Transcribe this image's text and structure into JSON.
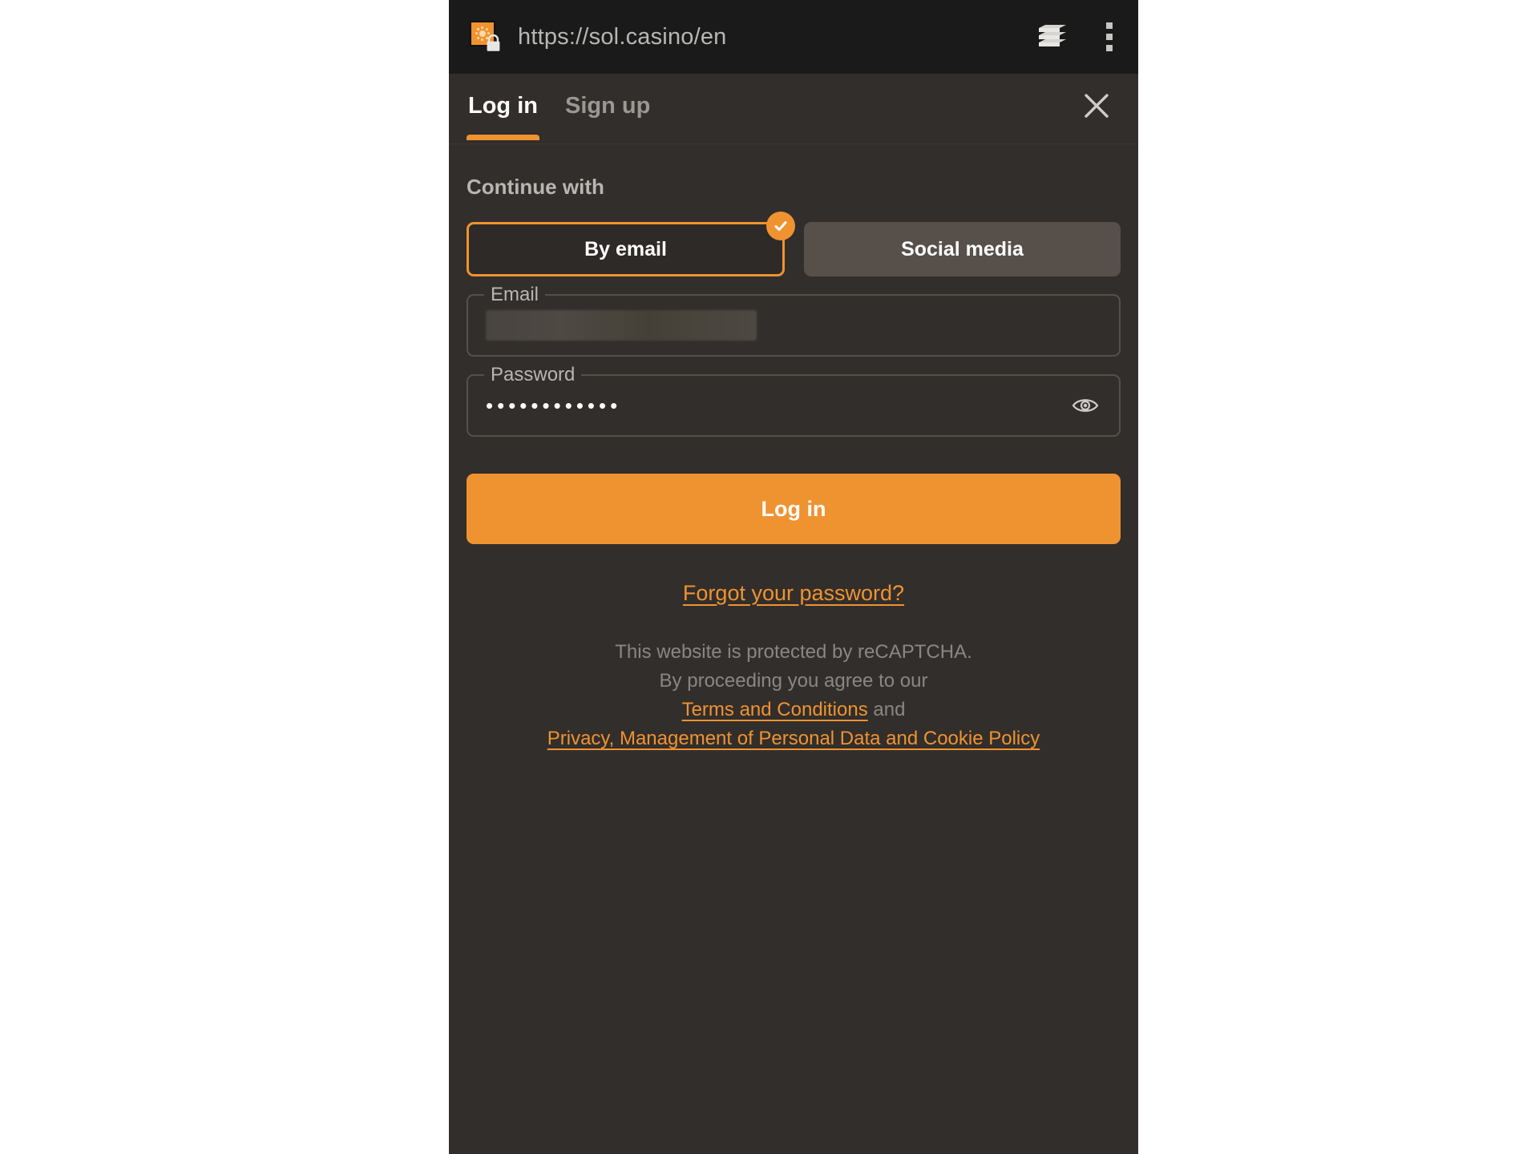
{
  "browser": {
    "url": "https://sol.casino/en",
    "favicon_name": "sol-casino-favicon",
    "lock_icon": "lock-icon",
    "tabs_icon": "tab-stack-icon",
    "menu_icon": "three-dot-menu-icon"
  },
  "modal": {
    "tabs": [
      {
        "label": "Log in",
        "active": true
      },
      {
        "label": "Sign up",
        "active": false
      }
    ],
    "close_icon": "close-icon",
    "section_title": "Continue with",
    "methods": [
      {
        "label": "By email",
        "selected": true,
        "badge_icon": "check-icon"
      },
      {
        "label": "Social media",
        "selected": false
      }
    ],
    "fields": {
      "email": {
        "label": "Email",
        "value": "",
        "redacted": true
      },
      "password": {
        "label": "Password",
        "value": "••••••••••••",
        "toggle_icon": "eye-icon"
      }
    },
    "submit_label": "Log in",
    "forgot_label": "Forgot your password?",
    "legal": {
      "line1": "This website is protected by reCAPTCHA.",
      "line2": "By proceeding you agree to our",
      "terms_link": "Terms and Conditions",
      "conjunction": "and",
      "privacy_link": "Privacy, Management of Personal Data and Cookie Policy"
    }
  },
  "colors": {
    "accent": "#ef9331",
    "panel_bg": "#322e2b",
    "browser_bg": "#1a1a1a",
    "field_border": "#56504a",
    "muted_text": "#8a8783"
  }
}
